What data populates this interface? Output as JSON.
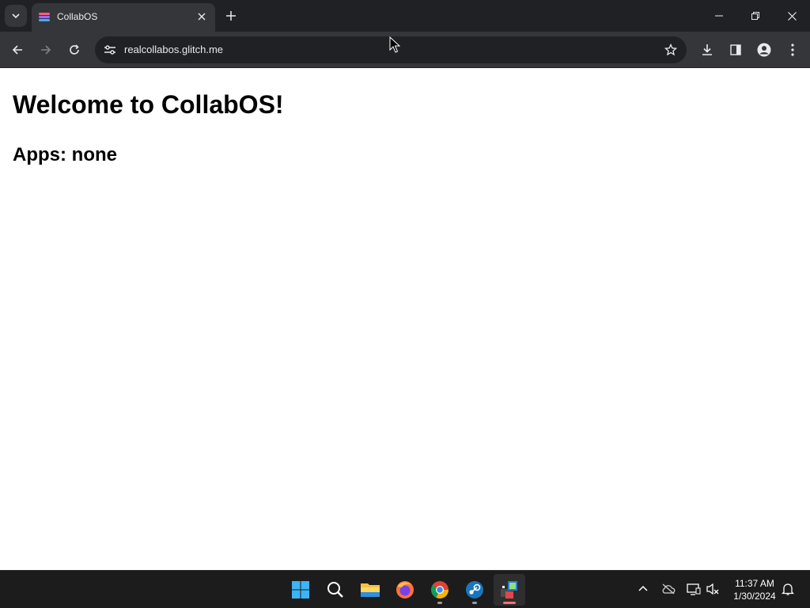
{
  "browser": {
    "tab": {
      "title": "CollabOS",
      "favicon": "collabos-favicon"
    },
    "address": {
      "url": "realcollabos.glitch.me"
    },
    "icons": {
      "tab_search": "chevron-down-icon",
      "tab_close": "close-icon",
      "new_tab": "plus-icon",
      "back": "arrow-left-icon",
      "forward": "arrow-right-icon",
      "reload": "reload-icon",
      "site_info": "tune-icon",
      "bookmark": "star-icon",
      "downloads": "download-icon",
      "side_panel": "side-panel-icon",
      "profile": "person-icon",
      "menu": "kebab-icon"
    },
    "colors": {
      "frame": "#202124",
      "toolbar": "#35363a",
      "text": "#e8eaed"
    }
  },
  "page": {
    "heading": "Welcome to CollabOS!",
    "apps_line": "Apps: none"
  },
  "taskbar": {
    "apps": [
      "windows-start",
      "search",
      "file-explorer",
      "firefox",
      "chrome",
      "steam",
      "active-app"
    ],
    "tray": [
      "chevron-up-icon",
      "cloud-off-icon",
      "display-icon",
      "speaker-muted-icon",
      "bell-icon"
    ],
    "time": "11:37 AM",
    "date": "1/30/2024",
    "colors": {
      "background": "#1c1c1c",
      "active_indicator": "#f0707a"
    }
  }
}
